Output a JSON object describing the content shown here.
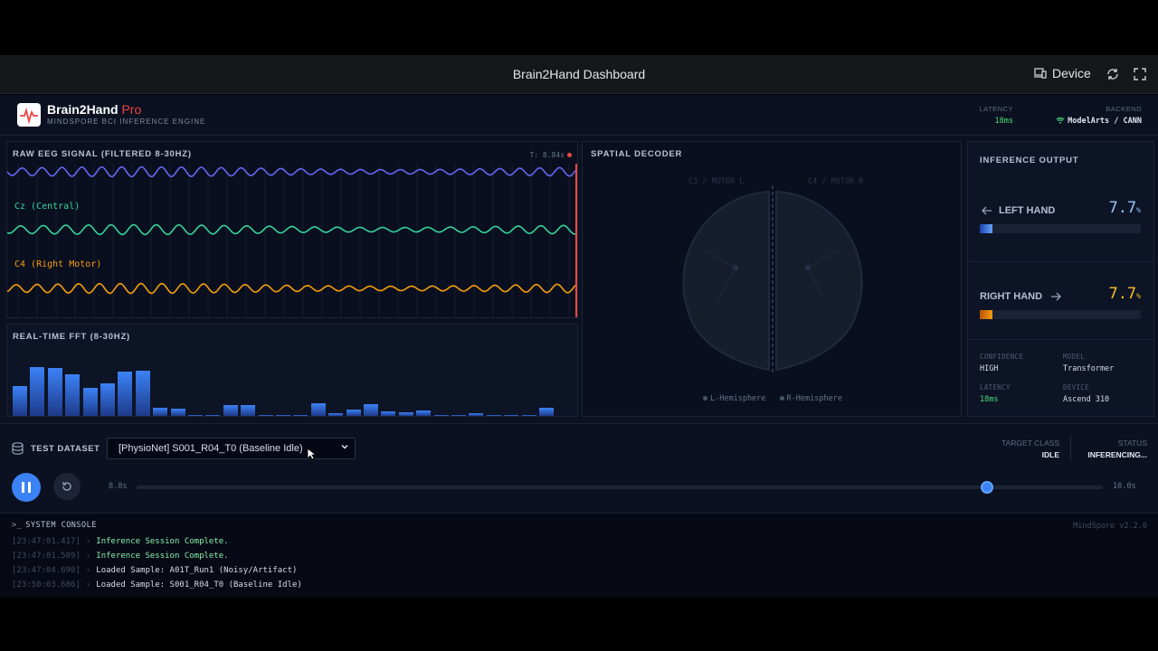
{
  "window": {
    "title": "Brain2Hand Dashboard",
    "device_label": "Device"
  },
  "header": {
    "brand": "Brain2Hand",
    "brand_suffix": "Pro",
    "subtitle": "MINDSPORE BCI INFERENCE ENGINE",
    "latency_label": "LATENCY",
    "latency_value": "18ms",
    "backend_label": "BACKEND",
    "backend_value": "ModelArts / CANN"
  },
  "eeg": {
    "title": "RAW EEG SIGNAL (FILTERED 8-30HZ)",
    "time_readout": "T: 8.84s",
    "channels": [
      {
        "label": "Cz (Central)",
        "color": "#34d399"
      },
      {
        "label": "C4 (Right Motor)",
        "color": "#f59e0b"
      }
    ],
    "top_color": "#6366f1"
  },
  "fft": {
    "title": "REAL-TIME FFT (8-30HZ)",
    "levels": [
      0.47,
      0.77,
      0.76,
      0.66,
      0.45,
      0.52,
      0.7,
      0.72,
      0.13,
      0.11,
      0,
      0,
      0.17,
      0.17,
      0,
      0,
      0,
      0.2,
      0.04,
      0.1,
      0.18,
      0.07,
      0.06,
      0.09,
      0,
      0,
      0.04,
      0,
      0,
      0,
      0.13
    ]
  },
  "spatial": {
    "title": "SPATIAL DECODER",
    "left_label": "C3 / MOTOR L",
    "right_label": "C4 / MOTOR R",
    "legend_left": "L-Hemisphere",
    "legend_right": "R-Hemisphere"
  },
  "inference": {
    "title": "INFERENCE OUTPUT",
    "left_label": "LEFT HAND",
    "left_value": "7.7",
    "left_level": 0.077,
    "right_label": "RIGHT HAND",
    "right_value": "7.7",
    "right_level": 0.077,
    "unit": "%",
    "confidence_label": "CONFIDENCE",
    "confidence_value": "HIGH",
    "model_label": "MODEL",
    "model_value": "Transformer",
    "latency_label": "LATENCY",
    "latency_value": "18ms",
    "device_label": "DEVICE",
    "device_value": "Ascend 310"
  },
  "controls": {
    "dataset_label": "TEST DATASET",
    "dataset_selected": "[PhysioNet] S001_R04_T0 (Baseline Idle)",
    "target_label": "TARGET CLASS",
    "target_value": "IDLE",
    "status_label": "STATUS",
    "status_value": "INFERENCING...",
    "time_current": "8.8s",
    "time_end": "10.0s",
    "progress": 0.88
  },
  "console": {
    "title": "SYSTEM CONSOLE",
    "version": "MindSpore v2.2.0",
    "lines": [
      {
        "ts": "[23:47:01.417]",
        "text": "Inference Session Complete.",
        "color": "#86efac"
      },
      {
        "ts": "[23:47:01.509]",
        "text": "Inference Session Complete.",
        "color": "#86efac"
      },
      {
        "ts": "[23:47:04.690]",
        "text": "Loaded Sample: A01T_Run1 (Noisy/Artifact)",
        "color": "#d7dde8"
      },
      {
        "ts": "[23:50:03.686]",
        "text": "Loaded Sample: S001_R04_T0 (Baseline Idle)",
        "color": "#d7dde8"
      }
    ]
  }
}
